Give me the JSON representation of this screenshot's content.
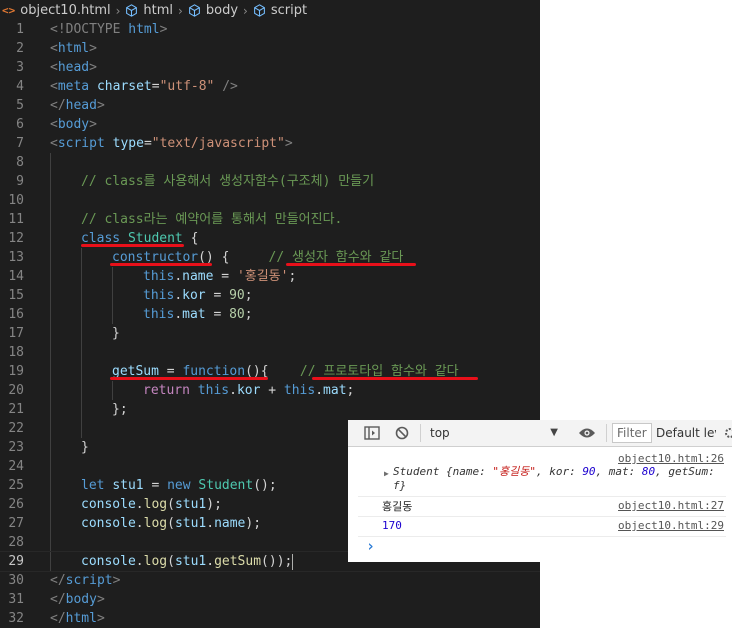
{
  "breadcrumb": {
    "file": "object10.html",
    "items": [
      "html",
      "body",
      "script"
    ]
  },
  "editor": {
    "line_numbers": [
      "1",
      "2",
      "3",
      "4",
      "5",
      "6",
      "7",
      "8",
      "9",
      "10",
      "11",
      "12",
      "13",
      "14",
      "15",
      "16",
      "17",
      "18",
      "19",
      "20",
      "21",
      "22",
      "23",
      "24",
      "25",
      "26",
      "27",
      "28",
      "29",
      "30",
      "31",
      "32"
    ]
  },
  "code": {
    "l1_a": "<!DOCTYPE ",
    "l1_b": "html",
    "l1_c": ">",
    "l2_a": "<",
    "l2_b": "html",
    "l2_c": ">",
    "l3_a": "<",
    "l3_b": "head",
    "l3_c": ">",
    "l4_a": "<",
    "l4_b": "meta",
    "l4_c": "charset",
    "l4_d": "=",
    "l4_e": "\"utf-8\"",
    "l4_f": " />",
    "l5_a": "</",
    "l5_b": "head",
    "l5_c": ">",
    "l6_a": "<",
    "l6_b": "body",
    "l6_c": ">",
    "l7_a": "<",
    "l7_b": "script",
    "l7_c": "type",
    "l7_d": "=",
    "l7_e": "\"text/javascript\"",
    "l7_f": ">",
    "l9": "// class를 사용해서 생성자함수(구조체) 만들기",
    "l11": "// class라는 예약어를 통해서 만들어진다.",
    "l12_a": "class",
    "l12_b": "Student",
    "l12_c": " {",
    "l13_a": "constructor",
    "l13_b": "() {",
    "l13_c": "// 생성자 함수와 같다",
    "l14_a": "this",
    "l14_b": ".",
    "l14_c": "name",
    "l14_d": " = ",
    "l14_e": "'홍길동'",
    "l14_f": ";",
    "l15_a": "this",
    "l15_b": ".",
    "l15_c": "kor",
    "l15_d": " = ",
    "l15_e": "90",
    "l15_f": ";",
    "l16_a": "this",
    "l16_b": ".",
    "l16_c": "mat",
    "l16_d": " = ",
    "l16_e": "80",
    "l16_f": ";",
    "l17": "}",
    "l19_a": "getSum",
    "l19_b": " = ",
    "l19_c": "function",
    "l19_d": "(){",
    "l19_e": "// 프로토타입 함수와 같다",
    "l20_a": "return",
    "l20_b": "this",
    "l20_c": ".",
    "l20_d": "kor",
    "l20_e": " + ",
    "l20_f": "this",
    "l20_g": ".",
    "l20_h": "mat",
    "l20_i": ";",
    "l21": "};",
    "l23": "}",
    "l25_a": "let",
    "l25_b": "stu1",
    "l25_c": " = ",
    "l25_d": "new",
    "l25_e": "Student",
    "l25_f": "();",
    "l26_a": "console",
    "l26_b": ".",
    "l26_c": "log",
    "l26_d": "(",
    "l26_e": "stu1",
    "l26_f": ");",
    "l27_a": "console",
    "l27_b": ".",
    "l27_c": "log",
    "l27_d": "(",
    "l27_e": "stu1",
    "l27_f": ".",
    "l27_g": "name",
    "l27_h": ");",
    "l29_a": "console",
    "l29_b": ".",
    "l29_c": "log",
    "l29_d": "(",
    "l29_e": "stu1",
    "l29_f": ".",
    "l29_g": "getSum",
    "l29_h": "());",
    "l30_a": "</",
    "l30_b": "script",
    "l30_c": ">",
    "l31_a": "</",
    "l31_b": "body",
    "l31_c": ">",
    "l32_a": "</",
    "l32_b": "html",
    "l32_c": ">"
  },
  "console": {
    "context": "top",
    "filter_placeholder": "Filter",
    "levels": "Default lev",
    "msg1": {
      "source": "object10.html:26",
      "cls": "Student",
      "p1": " {name: ",
      "name_val": "\"홍길동\"",
      "p2": ", kor: ",
      "kor_val": "90",
      "p3": ", mat: ",
      "mat_val": "80",
      "p4": ", getSum:",
      "fn": "f",
      "end": "}"
    },
    "msg2": {
      "text": "홍길동",
      "source": "object10.html:27"
    },
    "msg3": {
      "text": "170",
      "source": "object10.html:29"
    },
    "prompt": "›"
  },
  "colors": {
    "editor_bg": "#1e1e1e",
    "underline": "#e8101a",
    "comment": "#6a9955",
    "keyword": "#569cd6",
    "class_name": "#4ec9b0"
  }
}
